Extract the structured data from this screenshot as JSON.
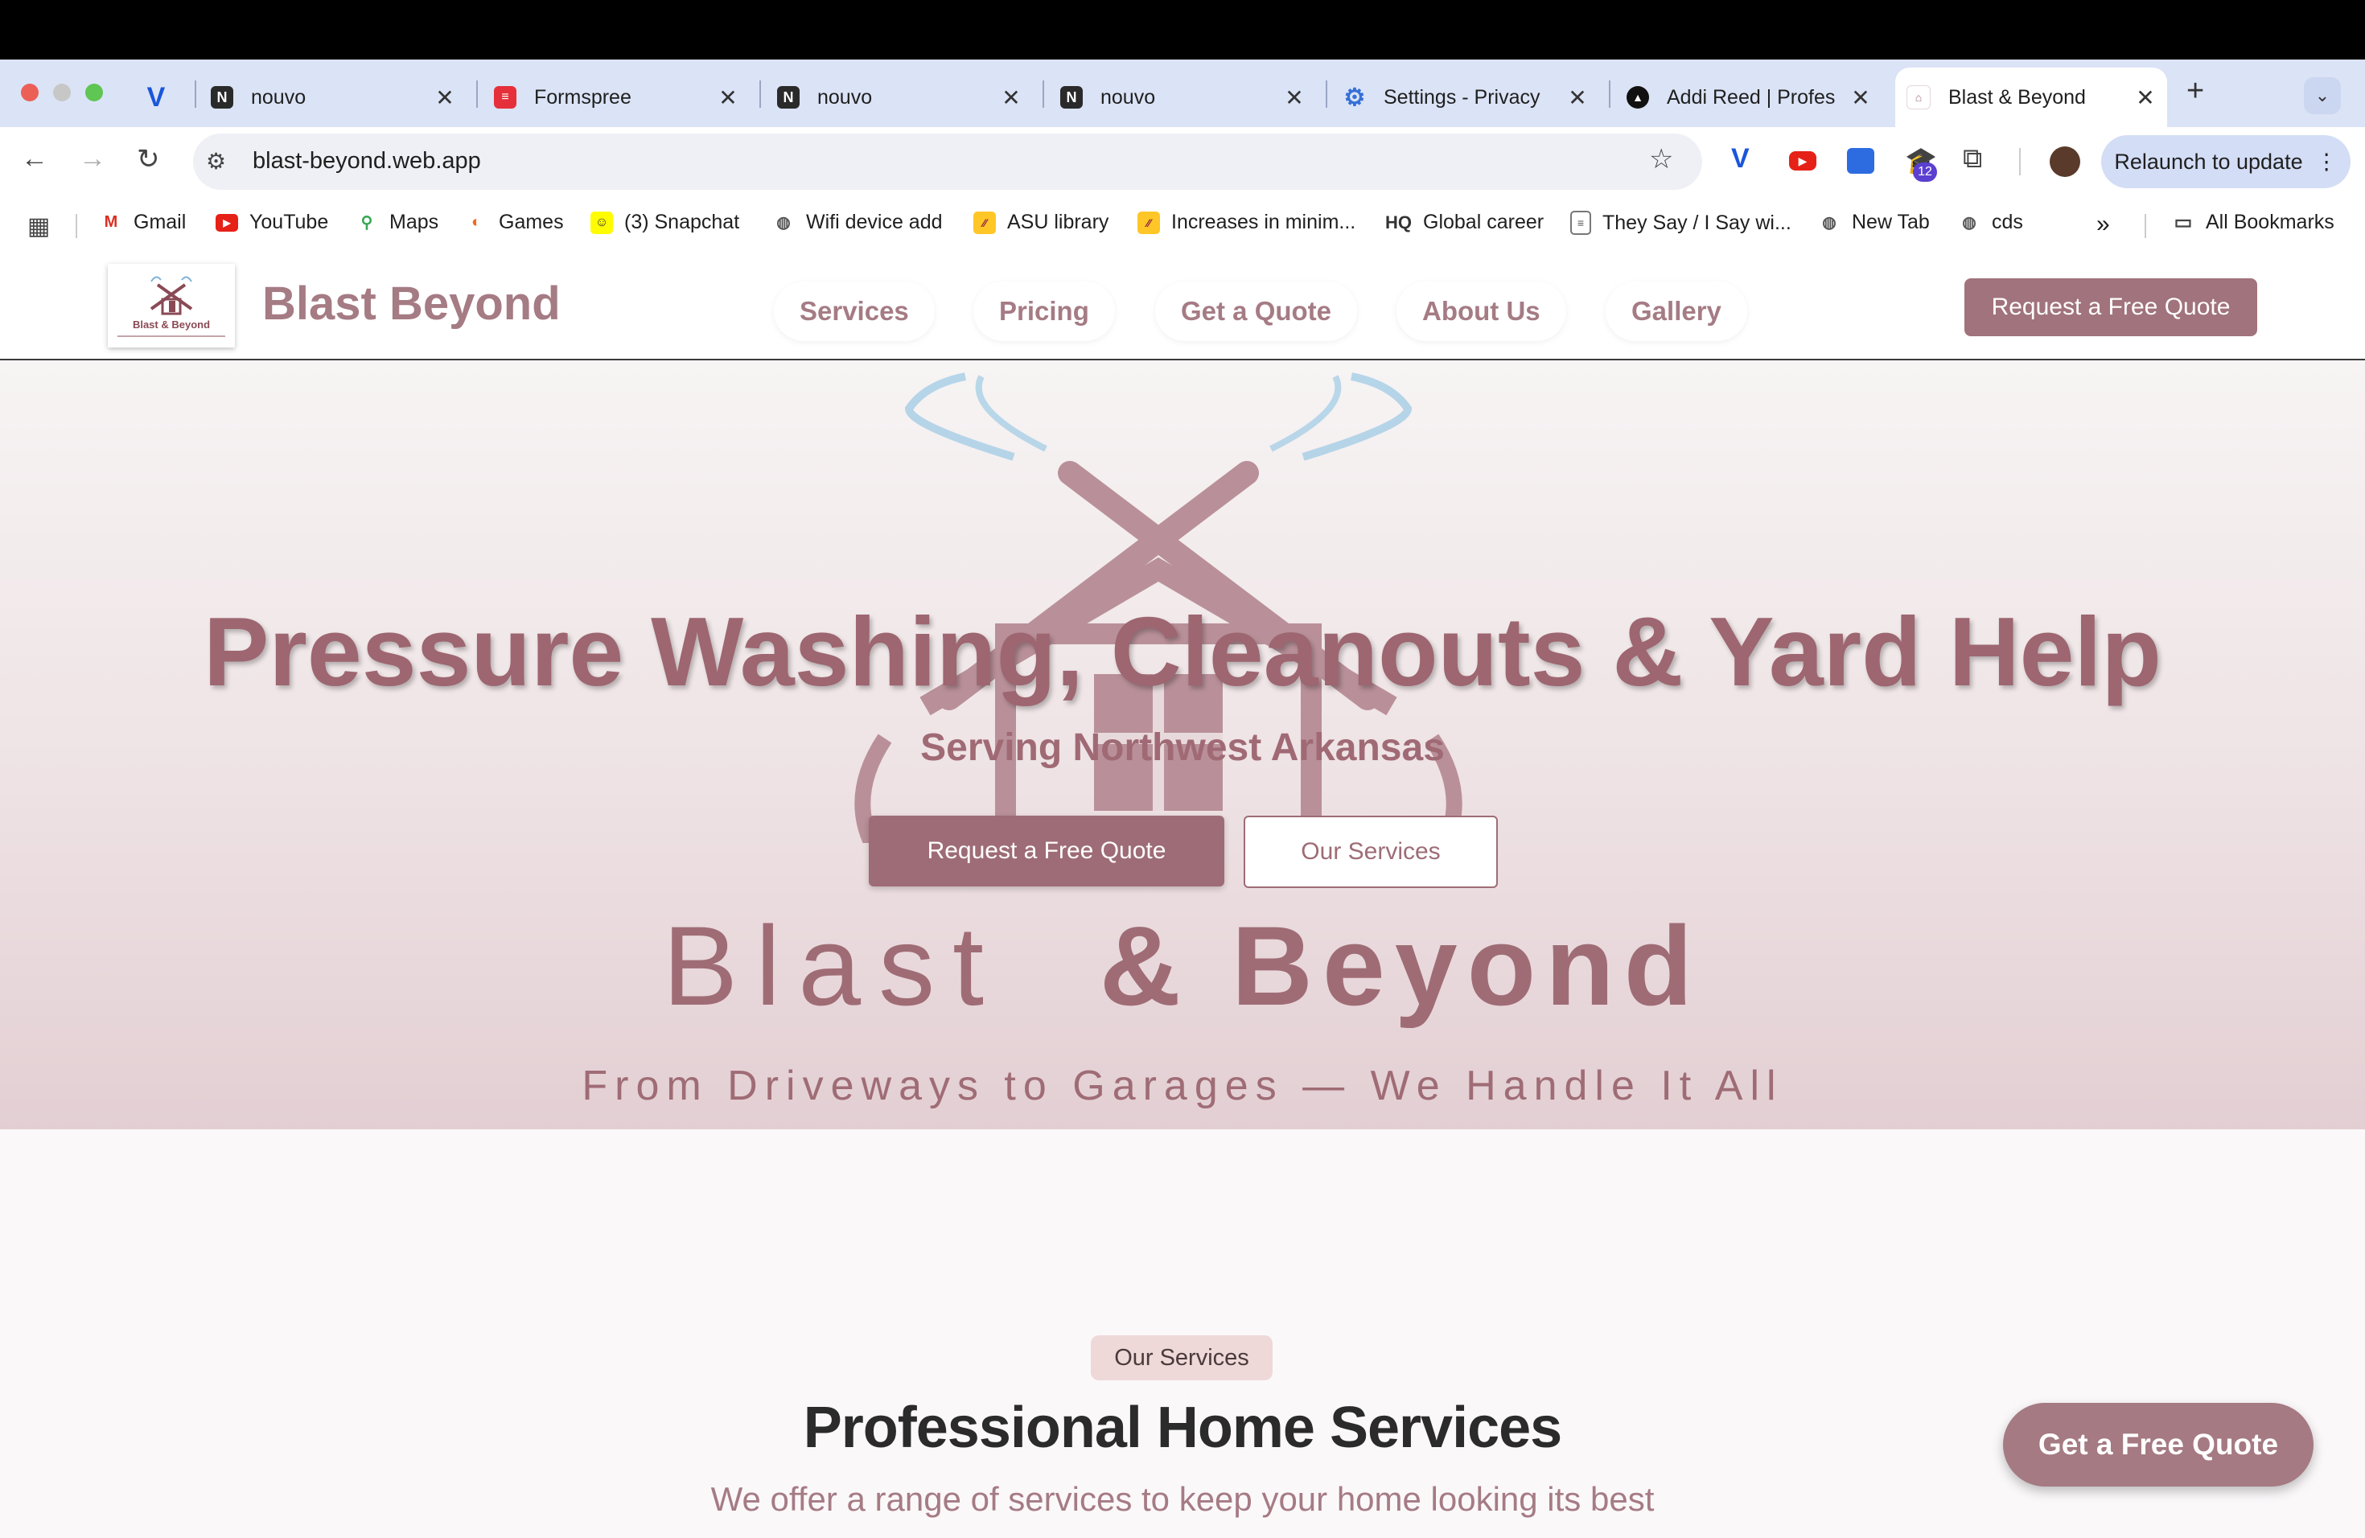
{
  "browser": {
    "tabs": [
      {
        "title": "",
        "icon": "v-logo-icon"
      },
      {
        "title": "nouvo",
        "icon": "notion-icon"
      },
      {
        "title": "Formspree",
        "icon": "formspree-icon"
      },
      {
        "title": "nouvo",
        "icon": "notion-icon"
      },
      {
        "title": "nouvo",
        "icon": "notion-icon"
      },
      {
        "title": "Settings - Privacy",
        "icon": "gear-icon"
      },
      {
        "title": "Addi Reed | Profes",
        "icon": "triangle-logo-icon"
      },
      {
        "title": "Blast & Beyond",
        "icon": "blast-beyond-favicon"
      }
    ],
    "new_tab": "+",
    "url": "blast-beyond.web.app",
    "relaunch_label": "Relaunch to update",
    "extension_badge": "12",
    "bookmarks": [
      {
        "label": "Gmail"
      },
      {
        "label": "YouTube"
      },
      {
        "label": "Maps"
      },
      {
        "label": "Games"
      },
      {
        "label": "(3) Snapchat"
      },
      {
        "label": "Wifi device add"
      },
      {
        "label": "ASU library"
      },
      {
        "label": "Increases in minim..."
      },
      {
        "label": "Global career",
        "prefix": "HQ"
      },
      {
        "label": "They Say / I Say wi..."
      },
      {
        "label": "New Tab"
      },
      {
        "label": "cds"
      }
    ],
    "more_bookmarks": "»",
    "all_bookmarks": "All Bookmarks"
  },
  "site": {
    "brand": "Blast Beyond",
    "logo_text": "Blast & Beyond",
    "nav": [
      "Services",
      "Pricing",
      "Get a Quote",
      "About Us",
      "Gallery"
    ],
    "header_cta": "Request a Free Quote",
    "hero": {
      "title": "Pressure Washing, Cleanouts & Yard Help",
      "subtitle": "Serving Northwest Arkansas",
      "primary_button": "Request a Free Quote",
      "secondary_button": "Our Services",
      "watermark_word1": "Blast",
      "watermark_word2": "& Beyond",
      "tagline": "From Driveways to Garages — We Handle It All"
    },
    "services": {
      "pill": "Our Services",
      "title": "Professional Home Services",
      "subtitle": "We offer a range of services to keep your home looking its best"
    },
    "floating_cta": "Get a Free Quote"
  },
  "colors": {
    "brand": "#a57b84",
    "brand_dark": "#9e6c76",
    "tab_strip": "#dbe3f6"
  }
}
